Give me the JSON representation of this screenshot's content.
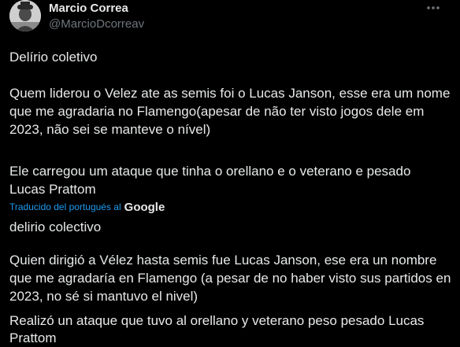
{
  "author": {
    "name": "Marcio Correa",
    "handle": "@MarcioDcorreav",
    "avatar_icon": "user-avatar"
  },
  "tweet": {
    "original": {
      "title": "Delírio coletivo",
      "p1_line1": "Quem liderou o Velez ate as semis foi o Lucas Janson, esse era um nome",
      "p1_line2": "que me agradaria no Flamengo(apesar de não ter visto jogos dele em",
      "p1_line3": "2023, não sei se manteve o nível)",
      "p2_line1": "Ele carregou um ataque que tinha o orellano e o veterano e pesado",
      "p2_line2": "Lucas Prattom"
    },
    "translation_label": "Traducido del portugués al",
    "translation_provider": "Google",
    "translated": {
      "title": "delirio colectivo",
      "p1_line1": "Quien dirigió a Vélez hasta semis fue Lucas Janson, ese era un nombre",
      "p1_line2": "que me agradaría en Flamengo (a pesar de no haber visto sus partidos en",
      "p1_line3": "2023, no sé si mantuvo el nivel)",
      "p2_line1": "Realizó un ataque que tuvo al orellano y veterano peso pesado Lucas",
      "p2_line2": "Prattom"
    }
  },
  "colors": {
    "background": "#000000",
    "text": "#e7e9ea",
    "secondary": "#71767b",
    "accent": "#1d9bf0"
  },
  "icons": {
    "more": "more-dots-icon"
  }
}
